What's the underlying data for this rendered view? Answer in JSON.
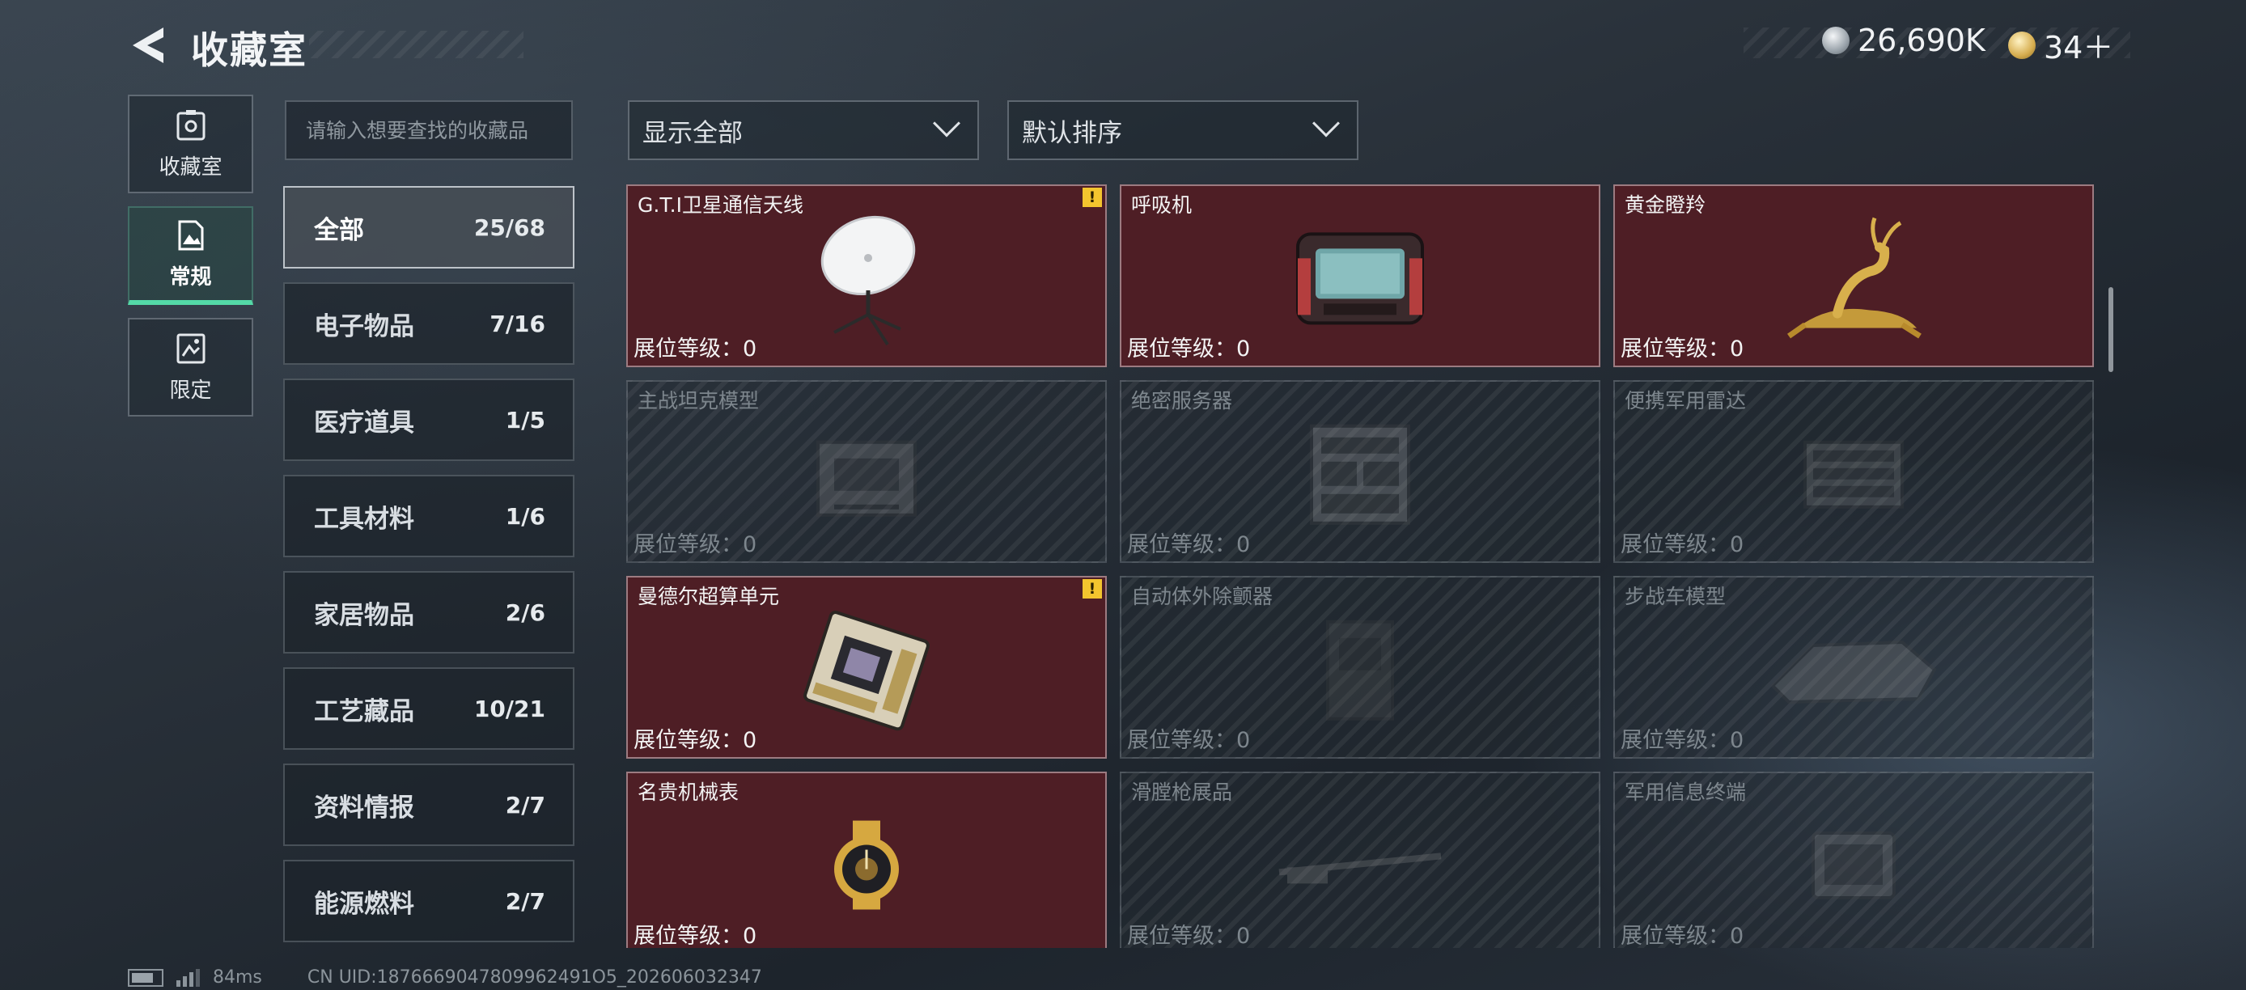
{
  "header": {
    "title": "收藏室",
    "currency_silver": "26,690K",
    "currency_gold": "34＋"
  },
  "side_nav": [
    {
      "label": "收藏室",
      "icon": "collection-room-icon"
    },
    {
      "label": "常规",
      "icon": "regular-icon",
      "active": true
    },
    {
      "label": "限定",
      "icon": "limited-icon"
    }
  ],
  "search": {
    "placeholder": "请输入想要查找的收藏品"
  },
  "filters": {
    "display": "显示全部",
    "sort": "默认排序"
  },
  "categories": [
    {
      "label": "全部",
      "count": "25/68",
      "active": true
    },
    {
      "label": "电子物品",
      "count": "7/16"
    },
    {
      "label": "医疗道具",
      "count": "1/5"
    },
    {
      "label": "工具材料",
      "count": "1/6"
    },
    {
      "label": "家居物品",
      "count": "2/6"
    },
    {
      "label": "工艺藏品",
      "count": "10/21"
    },
    {
      "label": "资料情报",
      "count": "2/7"
    },
    {
      "label": "能源燃料",
      "count": "2/7"
    }
  ],
  "items": [
    {
      "name": "",
      "level": "展位等级：0",
      "unlocked": false,
      "art": "generic-device"
    },
    {
      "name": "",
      "level": "展位等级：0",
      "unlocked": true,
      "art": "server-rack"
    },
    {
      "name": "",
      "level": "展位等级：0",
      "unlocked": false,
      "art": "generic-device"
    },
    {
      "name": "G.T.I卫星通信天线",
      "level": "展位等级：0",
      "unlocked": true,
      "warn": true,
      "art": "satellite-dish"
    },
    {
      "name": "呼吸机",
      "level": "展位等级：0",
      "unlocked": true,
      "art": "ventilator"
    },
    {
      "name": "黄金瞪羚",
      "level": "展位等级：0",
      "unlocked": true,
      "art": "golden-gazelle"
    },
    {
      "name": "主战坦克模型",
      "level": "展位等级：0",
      "unlocked": false,
      "art": "tank-model"
    },
    {
      "name": "绝密服务器",
      "level": "展位等级：0",
      "unlocked": false,
      "art": "server-rack"
    },
    {
      "name": "便携军用雷达",
      "level": "展位等级：0",
      "unlocked": false,
      "art": "radar"
    },
    {
      "name": "曼德尔超算单元",
      "level": "展位等级：0",
      "unlocked": true,
      "warn": true,
      "art": "supercomputer-board"
    },
    {
      "name": "自动体外除颤器",
      "level": "展位等级：0",
      "unlocked": false,
      "art": "defibrillator"
    },
    {
      "name": "步战车模型",
      "level": "展位等级：0",
      "unlocked": false,
      "art": "ifv-model"
    },
    {
      "name": "名贵机械表",
      "level": "展位等级：0",
      "unlocked": true,
      "art": "luxury-watch"
    },
    {
      "name": "滑膛枪展品",
      "level": "展位等级：0",
      "unlocked": false,
      "art": "musket"
    },
    {
      "name": "军用信息终端",
      "level": "展位等级：0",
      "unlocked": false,
      "art": "info-terminal"
    }
  ],
  "status_bar": {
    "ping": "84ms",
    "uid": "CN UID:1876669047809962491O5_202606032347"
  },
  "colors": {
    "accent": "#54d9a7",
    "unlocked_card": "#4e1e25",
    "warning": "#f3c52e"
  }
}
